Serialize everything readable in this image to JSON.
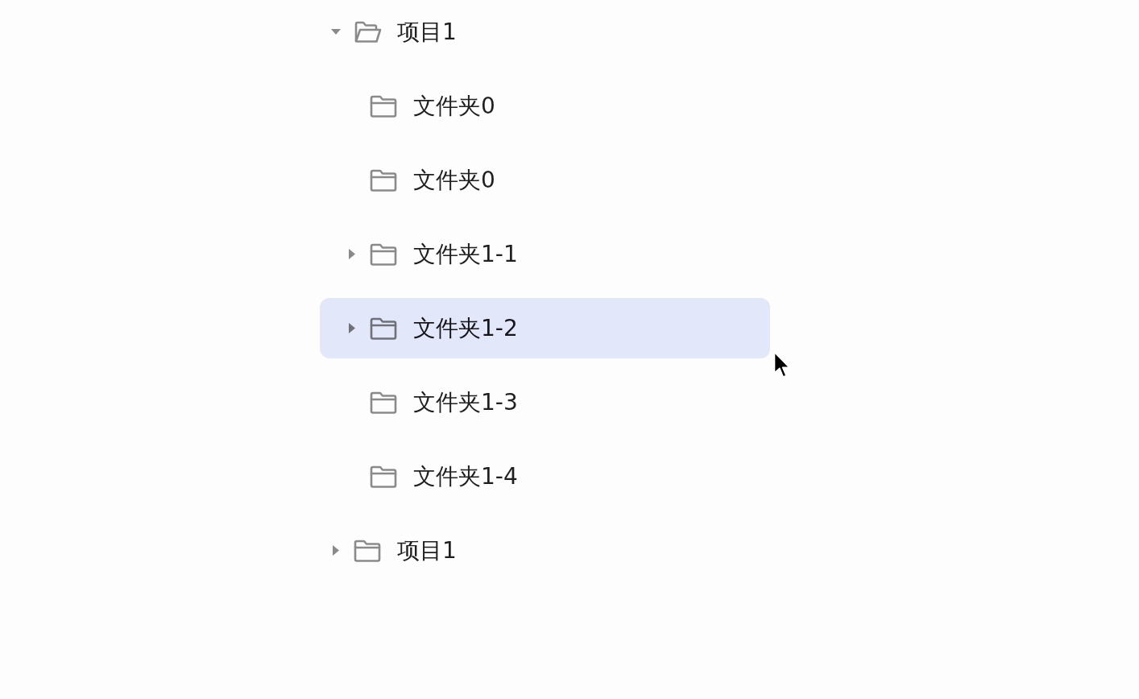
{
  "tree": {
    "items": [
      {
        "label": "项目1",
        "kind": "branch",
        "expanded": true,
        "selected": false,
        "children": [
          {
            "label": "文件夹0",
            "kind": "leaf",
            "expanded": false,
            "selected": false
          },
          {
            "label": "文件夹0",
            "kind": "leaf",
            "expanded": false,
            "selected": false
          },
          {
            "label": "文件夹1-1",
            "kind": "branch",
            "expanded": false,
            "selected": false
          },
          {
            "label": "文件夹1-2",
            "kind": "branch",
            "expanded": false,
            "selected": true
          },
          {
            "label": "文件夹1-3",
            "kind": "leaf",
            "expanded": false,
            "selected": false
          },
          {
            "label": "文件夹1-4",
            "kind": "leaf",
            "expanded": false,
            "selected": false
          }
        ]
      },
      {
        "label": "项目1",
        "kind": "branch",
        "expanded": false,
        "selected": false
      }
    ]
  }
}
